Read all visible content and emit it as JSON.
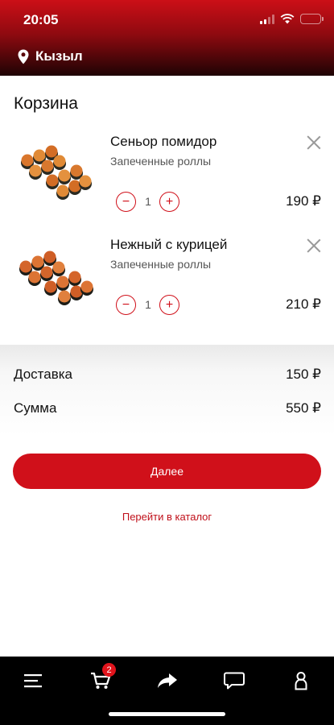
{
  "status": {
    "time": "20:05"
  },
  "header": {
    "city": "Кызыл",
    "icon": "location-pin-icon"
  },
  "page": {
    "title": "Корзина"
  },
  "cart": {
    "items": [
      {
        "name": "Сеньор помидор",
        "category": "Запеченные роллы",
        "quantity": "1",
        "price": "190 ₽",
        "decrement": "−",
        "increment": "+"
      },
      {
        "name": "Нежный с курицей",
        "category": "Запеченные роллы",
        "quantity": "1",
        "price": "210 ₽",
        "decrement": "−",
        "increment": "+"
      }
    ]
  },
  "totals": {
    "delivery_label": "Доставка",
    "delivery_value": "150 ₽",
    "sum_label": "Сумма",
    "sum_value": "550 ₽"
  },
  "actions": {
    "next_label": "Далее",
    "catalog_label": "Перейти в каталог"
  },
  "tabbar": {
    "tabs": [
      "menu-icon",
      "cart-icon",
      "share-icon",
      "chat-icon",
      "profile-icon"
    ],
    "cart_badge": "2"
  },
  "colors": {
    "accent": "#d0101a",
    "header_top": "#cc0f17",
    "tabbar": "#000000"
  }
}
